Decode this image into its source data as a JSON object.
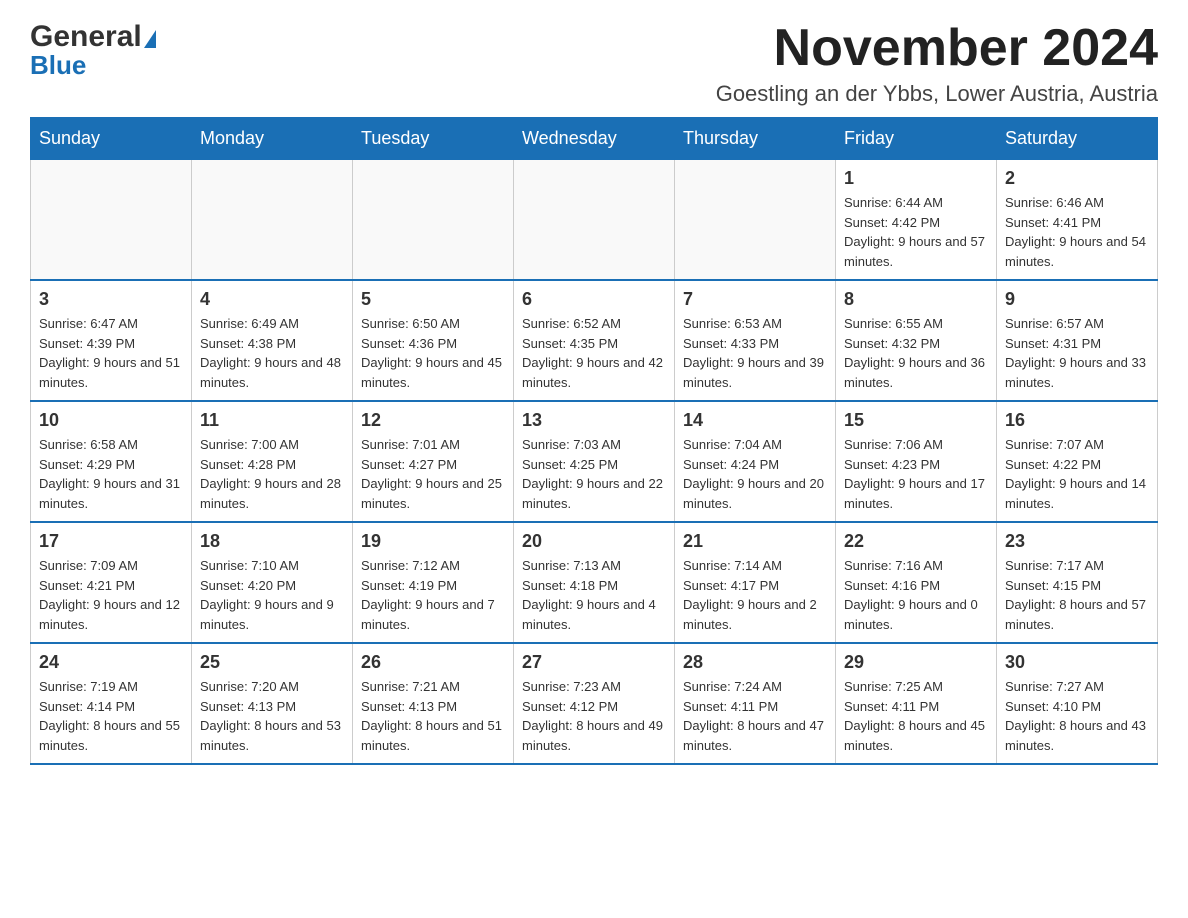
{
  "header": {
    "logo_general": "General",
    "logo_blue": "Blue",
    "main_title": "November 2024",
    "subtitle": "Goestling an der Ybbs, Lower Austria, Austria"
  },
  "weekdays": [
    "Sunday",
    "Monday",
    "Tuesday",
    "Wednesday",
    "Thursday",
    "Friday",
    "Saturday"
  ],
  "weeks": [
    [
      {
        "day": "",
        "info": ""
      },
      {
        "day": "",
        "info": ""
      },
      {
        "day": "",
        "info": ""
      },
      {
        "day": "",
        "info": ""
      },
      {
        "day": "",
        "info": ""
      },
      {
        "day": "1",
        "info": "Sunrise: 6:44 AM\nSunset: 4:42 PM\nDaylight: 9 hours and 57 minutes."
      },
      {
        "day": "2",
        "info": "Sunrise: 6:46 AM\nSunset: 4:41 PM\nDaylight: 9 hours and 54 minutes."
      }
    ],
    [
      {
        "day": "3",
        "info": "Sunrise: 6:47 AM\nSunset: 4:39 PM\nDaylight: 9 hours and 51 minutes."
      },
      {
        "day": "4",
        "info": "Sunrise: 6:49 AM\nSunset: 4:38 PM\nDaylight: 9 hours and 48 minutes."
      },
      {
        "day": "5",
        "info": "Sunrise: 6:50 AM\nSunset: 4:36 PM\nDaylight: 9 hours and 45 minutes."
      },
      {
        "day": "6",
        "info": "Sunrise: 6:52 AM\nSunset: 4:35 PM\nDaylight: 9 hours and 42 minutes."
      },
      {
        "day": "7",
        "info": "Sunrise: 6:53 AM\nSunset: 4:33 PM\nDaylight: 9 hours and 39 minutes."
      },
      {
        "day": "8",
        "info": "Sunrise: 6:55 AM\nSunset: 4:32 PM\nDaylight: 9 hours and 36 minutes."
      },
      {
        "day": "9",
        "info": "Sunrise: 6:57 AM\nSunset: 4:31 PM\nDaylight: 9 hours and 33 minutes."
      }
    ],
    [
      {
        "day": "10",
        "info": "Sunrise: 6:58 AM\nSunset: 4:29 PM\nDaylight: 9 hours and 31 minutes."
      },
      {
        "day": "11",
        "info": "Sunrise: 7:00 AM\nSunset: 4:28 PM\nDaylight: 9 hours and 28 minutes."
      },
      {
        "day": "12",
        "info": "Sunrise: 7:01 AM\nSunset: 4:27 PM\nDaylight: 9 hours and 25 minutes."
      },
      {
        "day": "13",
        "info": "Sunrise: 7:03 AM\nSunset: 4:25 PM\nDaylight: 9 hours and 22 minutes."
      },
      {
        "day": "14",
        "info": "Sunrise: 7:04 AM\nSunset: 4:24 PM\nDaylight: 9 hours and 20 minutes."
      },
      {
        "day": "15",
        "info": "Sunrise: 7:06 AM\nSunset: 4:23 PM\nDaylight: 9 hours and 17 minutes."
      },
      {
        "day": "16",
        "info": "Sunrise: 7:07 AM\nSunset: 4:22 PM\nDaylight: 9 hours and 14 minutes."
      }
    ],
    [
      {
        "day": "17",
        "info": "Sunrise: 7:09 AM\nSunset: 4:21 PM\nDaylight: 9 hours and 12 minutes."
      },
      {
        "day": "18",
        "info": "Sunrise: 7:10 AM\nSunset: 4:20 PM\nDaylight: 9 hours and 9 minutes."
      },
      {
        "day": "19",
        "info": "Sunrise: 7:12 AM\nSunset: 4:19 PM\nDaylight: 9 hours and 7 minutes."
      },
      {
        "day": "20",
        "info": "Sunrise: 7:13 AM\nSunset: 4:18 PM\nDaylight: 9 hours and 4 minutes."
      },
      {
        "day": "21",
        "info": "Sunrise: 7:14 AM\nSunset: 4:17 PM\nDaylight: 9 hours and 2 minutes."
      },
      {
        "day": "22",
        "info": "Sunrise: 7:16 AM\nSunset: 4:16 PM\nDaylight: 9 hours and 0 minutes."
      },
      {
        "day": "23",
        "info": "Sunrise: 7:17 AM\nSunset: 4:15 PM\nDaylight: 8 hours and 57 minutes."
      }
    ],
    [
      {
        "day": "24",
        "info": "Sunrise: 7:19 AM\nSunset: 4:14 PM\nDaylight: 8 hours and 55 minutes."
      },
      {
        "day": "25",
        "info": "Sunrise: 7:20 AM\nSunset: 4:13 PM\nDaylight: 8 hours and 53 minutes."
      },
      {
        "day": "26",
        "info": "Sunrise: 7:21 AM\nSunset: 4:13 PM\nDaylight: 8 hours and 51 minutes."
      },
      {
        "day": "27",
        "info": "Sunrise: 7:23 AM\nSunset: 4:12 PM\nDaylight: 8 hours and 49 minutes."
      },
      {
        "day": "28",
        "info": "Sunrise: 7:24 AM\nSunset: 4:11 PM\nDaylight: 8 hours and 47 minutes."
      },
      {
        "day": "29",
        "info": "Sunrise: 7:25 AM\nSunset: 4:11 PM\nDaylight: 8 hours and 45 minutes."
      },
      {
        "day": "30",
        "info": "Sunrise: 7:27 AM\nSunset: 4:10 PM\nDaylight: 8 hours and 43 minutes."
      }
    ]
  ]
}
